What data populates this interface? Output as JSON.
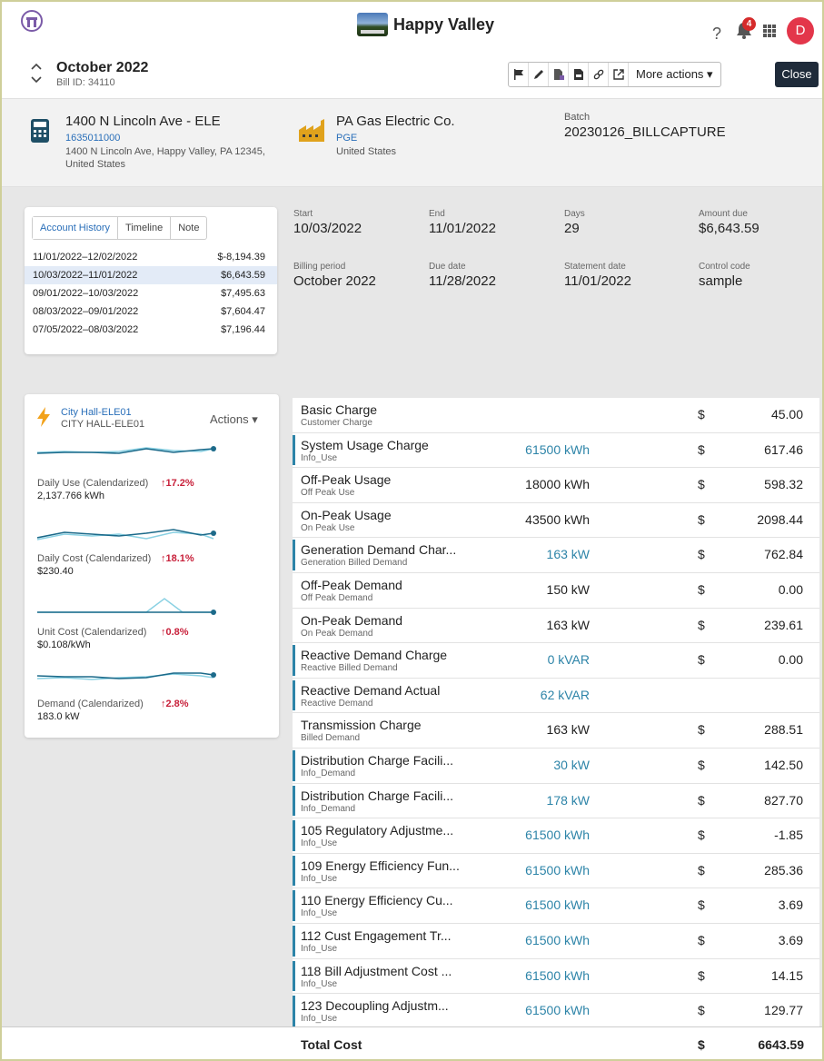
{
  "app": {
    "title": "Happy Valley",
    "notification_count": "4",
    "avatar_initial": "D",
    "help": "?"
  },
  "header": {
    "month": "October 2022",
    "bill_id": "Bill ID: 34110",
    "more_actions": "More actions ▾",
    "close": "Close"
  },
  "account": {
    "name": "1400 N Lincoln Ave - ELE",
    "number": "1635011000",
    "address": "1400 N Lincoln Ave, Happy Valley, PA 12345, United States"
  },
  "vendor": {
    "name": "PA Gas Electric Co.",
    "code": "PGE",
    "country": "United States"
  },
  "batch": {
    "label": "Batch",
    "value": "20230126_BILLCAPTURE"
  },
  "tabs": [
    "Account History",
    "Timeline",
    "Note"
  ],
  "history": [
    {
      "period": "11/01/2022–12/02/2022",
      "amount": "$-8,194.39"
    },
    {
      "period": "10/03/2022–11/01/2022",
      "amount": "$6,643.59"
    },
    {
      "period": "09/01/2022–10/03/2022",
      "amount": "$7,495.63"
    },
    {
      "period": "08/03/2022–09/01/2022",
      "amount": "$7,604.47"
    },
    {
      "period": "07/05/2022–08/03/2022",
      "amount": "$7,196.44"
    }
  ],
  "meta": {
    "start": {
      "label": "Start",
      "value": "10/03/2022"
    },
    "end": {
      "label": "End",
      "value": "11/01/2022"
    },
    "days": {
      "label": "Days",
      "value": "29"
    },
    "amount_due": {
      "label": "Amount due",
      "value": "$6,643.59"
    },
    "billing_period": {
      "label": "Billing period",
      "value": "October 2022"
    },
    "due_date": {
      "label": "Due date",
      "value": "11/28/2022"
    },
    "statement_date": {
      "label": "Statement date",
      "value": "11/01/2022"
    },
    "control_code": {
      "label": "Control code",
      "value": "sample"
    }
  },
  "meter": {
    "name": "City Hall-ELE01",
    "sub": "CITY HALL-ELE01",
    "actions": "Actions ▾",
    "metrics": [
      {
        "label": "Daily Use (Calendarized)",
        "value": "2,137.766 kWh",
        "change": "↑17.2%"
      },
      {
        "label": "Daily Cost (Calendarized)",
        "value": "$230.40",
        "change": "↑18.1%"
      },
      {
        "label": "Unit Cost (Calendarized)",
        "value": "$0.108/kWh",
        "change": "↑0.8%"
      },
      {
        "label": "Demand (Calendarized)",
        "value": "183.0 kW",
        "change": "↑2.8%"
      }
    ]
  },
  "charges": [
    {
      "name": "Basic Charge",
      "sub": "Customer Charge",
      "qty": "",
      "dollar": "$",
      "amount": "45.00",
      "accent": false,
      "qty_blue": false
    },
    {
      "name": "System Usage Charge",
      "sub": "Info_Use",
      "qty": "61500 kWh",
      "dollar": "$",
      "amount": "617.46",
      "accent": true,
      "qty_blue": true
    },
    {
      "name": "Off-Peak Usage",
      "sub": "Off Peak Use",
      "qty": "18000 kWh",
      "dollar": "$",
      "amount": "598.32",
      "accent": false,
      "qty_blue": false
    },
    {
      "name": "On-Peak Usage",
      "sub": "On Peak Use",
      "qty": "43500 kWh",
      "dollar": "$",
      "amount": "2098.44",
      "accent": false,
      "qty_blue": false
    },
    {
      "name": "Generation Demand Char...",
      "sub": "Generation Billed Demand",
      "qty": "163 kW",
      "dollar": "$",
      "amount": "762.84",
      "accent": true,
      "qty_blue": true
    },
    {
      "name": "Off-Peak Demand",
      "sub": "Off Peak Demand",
      "qty": "150 kW",
      "dollar": "$",
      "amount": "0.00",
      "accent": false,
      "qty_blue": false
    },
    {
      "name": "On-Peak Demand",
      "sub": "On Peak Demand",
      "qty": "163 kW",
      "dollar": "$",
      "amount": "239.61",
      "accent": false,
      "qty_blue": false
    },
    {
      "name": "Reactive Demand Charge",
      "sub": "Reactive Billed Demand",
      "qty": "0 kVAR",
      "dollar": "$",
      "amount": "0.00",
      "accent": true,
      "qty_blue": true
    },
    {
      "name": "Reactive Demand Actual",
      "sub": "Reactive Demand",
      "qty": "62 kVAR",
      "dollar": "",
      "amount": "",
      "accent": true,
      "qty_blue": true
    },
    {
      "name": "Transmission Charge",
      "sub": "Billed Demand",
      "qty": "163 kW",
      "dollar": "$",
      "amount": "288.51",
      "accent": false,
      "qty_blue": false
    },
    {
      "name": "Distribution Charge Facili...",
      "sub": "Info_Demand",
      "qty": "30 kW",
      "dollar": "$",
      "amount": "142.50",
      "accent": true,
      "qty_blue": true
    },
    {
      "name": "Distribution Charge Facili...",
      "sub": "Info_Demand",
      "qty": "178 kW",
      "dollar": "$",
      "amount": "827.70",
      "accent": true,
      "qty_blue": true
    },
    {
      "name": "105 Regulatory Adjustme...",
      "sub": "Info_Use",
      "qty": "61500 kWh",
      "dollar": "$",
      "amount": "-1.85",
      "accent": true,
      "qty_blue": true
    },
    {
      "name": "109 Energy Efficiency Fun...",
      "sub": "Info_Use",
      "qty": "61500 kWh",
      "dollar": "$",
      "amount": "285.36",
      "accent": true,
      "qty_blue": true
    },
    {
      "name": "110 Energy Efficiency Cu...",
      "sub": "Info_Use",
      "qty": "61500 kWh",
      "dollar": "$",
      "amount": "3.69",
      "accent": true,
      "qty_blue": true
    },
    {
      "name": "112 Cust Engagement Tr...",
      "sub": "Info_Use",
      "qty": "61500 kWh",
      "dollar": "$",
      "amount": "3.69",
      "accent": true,
      "qty_blue": true
    },
    {
      "name": "118 Bill Adjustment Cost ...",
      "sub": "Info_Use",
      "qty": "61500 kWh",
      "dollar": "$",
      "amount": "14.15",
      "accent": true,
      "qty_blue": true
    },
    {
      "name": "123 Decoupling Adjustm...",
      "sub": "Info_Use",
      "qty": "61500 kWh",
      "dollar": "$",
      "amount": "129.77",
      "accent": true,
      "qty_blue": true
    }
  ],
  "total": {
    "label": "Total Cost",
    "dollar": "$",
    "amount": "6643.59"
  },
  "colors": {
    "accent": "#2d84a8",
    "link": "#2a6fb9",
    "alert": "#c8203a",
    "close_bg": "#1f2b3a",
    "avatar": "#e3364a"
  },
  "icons": [
    "logo-icon",
    "bell-icon",
    "apps-grid-icon",
    "flag-icon",
    "pencil-icon",
    "file-chart-icon",
    "pdf-icon",
    "link-icon",
    "external-link-icon",
    "calculator-icon",
    "factory-icon",
    "bolt-icon"
  ]
}
